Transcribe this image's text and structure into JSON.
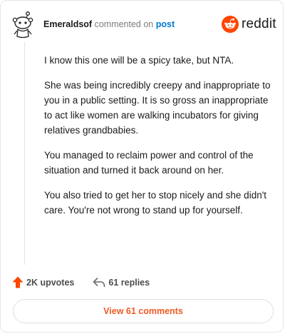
{
  "header": {
    "author": "Emeraldsof",
    "action_text": "commented on",
    "post_link": "post"
  },
  "logo": {
    "icon": "reddit-snoo-icon",
    "wordmark": "reddit"
  },
  "comment": {
    "paragraphs": [
      "I know this one will be a spicy take, but NTA.",
      "She was being incredibly creepy and inappropriate to you in a public setting. It is so gross an inappropriate to act like women are walking incubators for giving relatives grandbabies.",
      "You managed to reclaim power and control of the situation and turned it back around on her.",
      "You also tried to get her to stop nicely and she didn't care. You're not wrong to stand up for yourself."
    ]
  },
  "actions": {
    "upvotes_label": "2K upvotes",
    "replies_label": "61 replies"
  },
  "view_button": {
    "label": "View 61 comments"
  },
  "colors": {
    "brand": "#ff4500",
    "link": "#0079d3",
    "view_button_text": "#ee5a24"
  }
}
